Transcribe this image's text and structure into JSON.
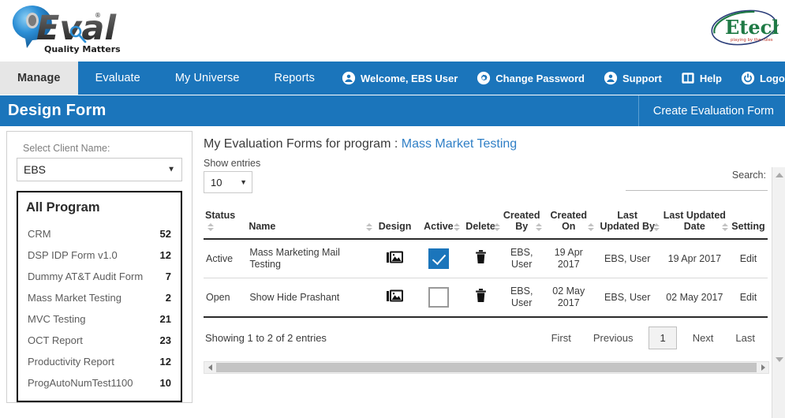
{
  "brand": {
    "product_logo_text": "QEval",
    "product_logo_tagline": "Quality Matters",
    "company_logo_text": "Etech",
    "company_logo_tagline": "playing by the rules"
  },
  "nav": {
    "tabs": [
      {
        "label": "Manage",
        "active": true
      },
      {
        "label": "Evaluate",
        "active": false
      },
      {
        "label": "My Universe",
        "active": false
      },
      {
        "label": "Reports",
        "active": false
      }
    ],
    "account_links": [
      {
        "label": "Welcome, EBS User",
        "icon": "user-circle-icon"
      },
      {
        "label": "Change Password",
        "icon": "gear-icon"
      },
      {
        "label": "Support",
        "icon": "user-circle-icon"
      },
      {
        "label": "Help",
        "icon": "book-icon"
      },
      {
        "label": "Logout",
        "icon": "power-icon"
      }
    ]
  },
  "titlebar": {
    "title": "Design Form",
    "action_label": "Create Evaluation Form"
  },
  "sidebar": {
    "select_label": "Select Client Name:",
    "selected_client": "EBS",
    "program_box_title": "All Program",
    "programs": [
      {
        "name": "CRM",
        "count": "52"
      },
      {
        "name": "DSP IDP Form v1.0",
        "count": "12"
      },
      {
        "name": "Dummy AT&T Audit Form",
        "count": "7"
      },
      {
        "name": "Mass Market Testing",
        "count": "2"
      },
      {
        "name": "MVC Testing",
        "count": "21"
      },
      {
        "name": "OCT Report",
        "count": "23"
      },
      {
        "name": "Productivity Report",
        "count": "12"
      },
      {
        "name": "ProgAutoNumTest1100",
        "count": "10"
      }
    ]
  },
  "main": {
    "heading_prefix": "My Evaluation Forms for program :",
    "heading_program": "Mass Market Testing",
    "show_entries_label": "Show entries",
    "entries_value": "10",
    "search_label": "Search:",
    "search_value": "",
    "search_placeholder": "",
    "table": {
      "columns": [
        {
          "label": "Status",
          "sortable": true
        },
        {
          "label": "Name",
          "sortable": true
        },
        {
          "label": "Design",
          "sortable": false
        },
        {
          "label": "Active",
          "sortable": true
        },
        {
          "label": "Delete",
          "sortable": true
        },
        {
          "label": "Created By",
          "sortable": true
        },
        {
          "label": "Created On",
          "sortable": true
        },
        {
          "label": "Last Updated By",
          "sortable": true
        },
        {
          "label": "Last Updated Date",
          "sortable": true
        },
        {
          "label": "Setting",
          "sortable": false
        }
      ],
      "rows": [
        {
          "status": "Active",
          "name": "Mass Marketing Mail Testing",
          "design_icon": "image-icon",
          "active_checked": true,
          "delete_icon": "trash-icon",
          "created_by": "EBS, User",
          "created_on": "19 Apr 2017",
          "last_updated_by": "EBS, User",
          "last_updated_date": "19 Apr 2017",
          "setting": "Edit"
        },
        {
          "status": "Open",
          "name": "Show Hide Prashant",
          "design_icon": "image-icon",
          "active_checked": false,
          "delete_icon": "trash-icon",
          "created_by": "EBS, User",
          "created_on": "02 May 2017",
          "last_updated_by": "EBS, User",
          "last_updated_date": "02 May 2017",
          "setting": "Edit"
        }
      ]
    },
    "footer": {
      "showing_text": "Showing 1 to 2 of 2 entries",
      "pagination": [
        {
          "label": "First",
          "current": false
        },
        {
          "label": "Previous",
          "current": false
        },
        {
          "label": "1",
          "current": true
        },
        {
          "label": "Next",
          "current": false
        },
        {
          "label": "Last",
          "current": false
        }
      ]
    }
  },
  "colors": {
    "brand_blue": "#1b75bb",
    "active_tab_bg": "#e6e6e6",
    "link_blue": "#2f7fc6",
    "etech_green": "#1f7a45"
  }
}
